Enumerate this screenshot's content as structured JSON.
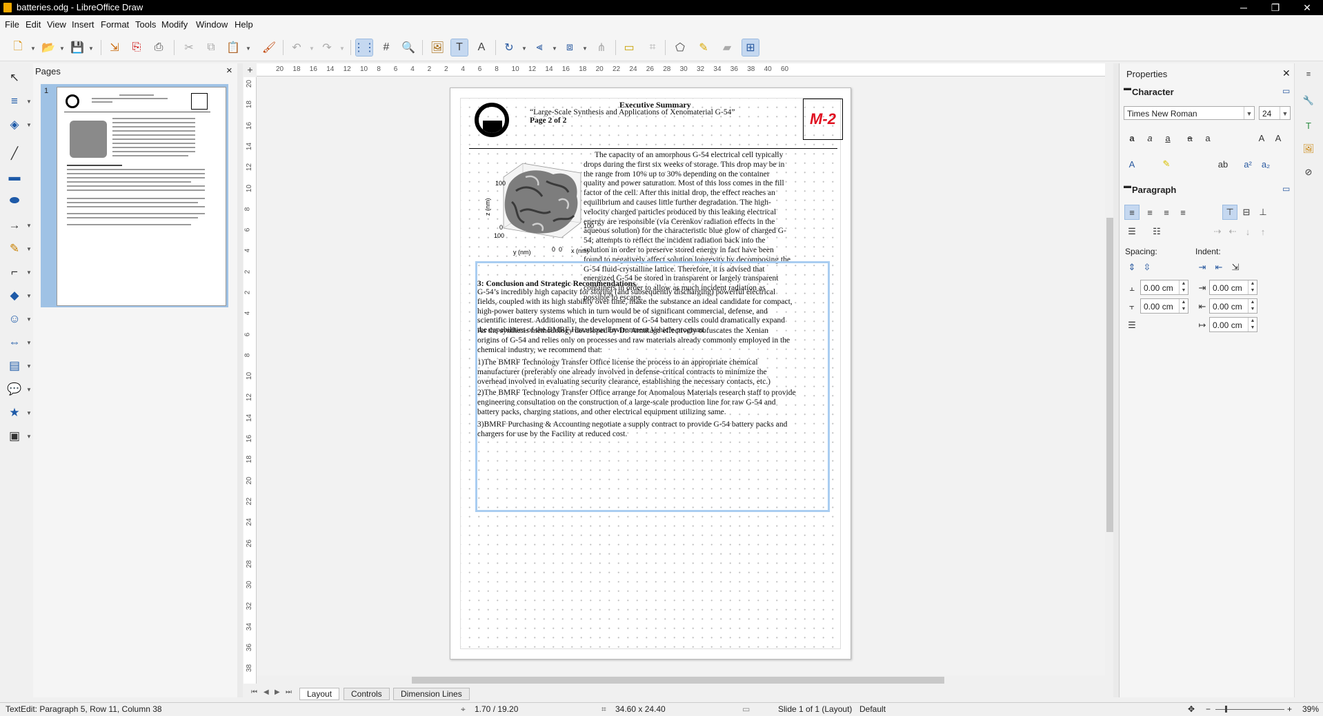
{
  "window": {
    "title": "batteries.odg - LibreOffice Draw",
    "minimize": "─",
    "restore": "❐",
    "close": "✕"
  },
  "menu": [
    "File",
    "Edit",
    "View",
    "Insert",
    "Format",
    "Tools",
    "Modify",
    "Window",
    "Help"
  ],
  "pages_panel": {
    "title": "Pages",
    "close": "×",
    "page_number": "1"
  },
  "rulers": {
    "horizontal": [
      "20",
      "18",
      "16",
      "14",
      "12",
      "10",
      "8",
      "6",
      "4",
      "2",
      "2",
      "4",
      "6",
      "8",
      "10",
      "12",
      "14",
      "16",
      "18",
      "20",
      "22",
      "24",
      "26",
      "28",
      "30",
      "32",
      "34",
      "36",
      "38",
      "40",
      "60"
    ],
    "vertical": [
      "20",
      "18",
      "16",
      "14",
      "12",
      "10",
      "8",
      "6",
      "4",
      "2",
      "2",
      "4",
      "6",
      "8",
      "10",
      "12",
      "14",
      "16",
      "18",
      "20",
      "22",
      "24",
      "26",
      "28",
      "30",
      "32",
      "34",
      "36",
      "38"
    ]
  },
  "document": {
    "title": "Executive Summary",
    "subtitle": "“Large-Scale Synthesis and Applications of Xenomaterial G-54”",
    "page_info": "Page 2 of 2",
    "logo_text": "M-2",
    "plot_labels": {
      "z_axis": "z (nm)",
      "y_axis": "y (nm)",
      "x_axis": "x (nm)",
      "z_max": "100",
      "z_min": "0",
      "y_max": "100",
      "y_min": "0",
      "x_min": "0",
      "x_max": "100"
    },
    "intro_paragraph": "The capacity of an amorphous G-54 electrical cell typically\ndrops during the first six weeks of storage. This drop may be in\nthe range from 10% up to 30% depending on the container\nquality and power saturation. Most of this loss comes in the fill\nfactor of the cell. After this initial drop, the effect reaches an\nequilibrium and causes little further degradation. The high-\nvelocity charged particles produced by this leaking electrical\nenergy are responsible (via Cerenkov radiation effects in the\naqueous solution) for the characteristic blue glow of charged G-\n54; attempts to reflect the incident radiation back into the\nsolution in order to preserve stored energy in fact have been\nfound to negatively affect solution longevity by decomposing the\nG-54 fluid-crystalline lattice. Therefore, it is advised that\nenergized G-54 be stored in transparent or largely transparent\ncontainers in order to allow as much incident radiation as\npossible to escape.",
    "section_heading": "3: Conclusion and Strategic Recommendations",
    "conclusion_p1": "G-54’s incredibly high capacity for storing (and subsequently discharging) powerful electrical\nfields, coupled with its high stability over time, make the substance an ideal candidate for compact,\nhigh-power battery systems which in turn would be of significant commercial, defense, and\nscientific interest. Additionally, the development of G-54 battery cells could dramatically expand\nthe capabilities of the BMRF Hazardous Environment Vehicle program.",
    "conclusion_p2": "As the synthesis methodology developed by Dr. Armitage effectively obfuscates the Xenian\norigins of G-54 and relies only on processes and raw materials already commonly employed in the\nchemical industry, we recommend that:",
    "rec_1": "1)The BMRF Technology Transfer Office license the process to an appropriate chemical\nmanufacturer (preferably one already involved in defense-critical contracts to minimize the\noverhead involved in evaluating security clearance, establishing the necessary contacts, etc.)",
    "rec_2": "2)The BMRF Technology Transfer Office arrange for Anomalous Materials research staff to provide\nengineering consultation on the construction of a large-scale production line for raw G-54 and\nbattery packs, charging stations, and other electrical equipment utilizing same.",
    "rec_3": "3)BMRF Purchasing & Accounting negotiate a supply contract to provide G-54 battery packs and\nchargers for use by the Facility at reduced cost."
  },
  "tabs": [
    "Layout",
    "Controls",
    "Dimension Lines"
  ],
  "sidebar": {
    "title": "Properties",
    "close": "✕",
    "character_section": "Character",
    "font_name": "Times New Roman",
    "font_size": "24",
    "paragraph_section": "Paragraph",
    "spacing_label": "Spacing:",
    "indent_label": "Indent:",
    "spacing_above": "0.00 cm",
    "spacing_below": "0.00 cm",
    "indent_before": "0.00 cm",
    "indent_after": "0.00 cm",
    "indent_first": "0.00 cm"
  },
  "status": {
    "edit_info": "TextEdit: Paragraph 5, Row 11, Column 38",
    "position": "1.70 / 19.20",
    "size": "34.60 x 24.40",
    "slide": "Slide 1 of 1 (Layout)",
    "master": "Default",
    "zoom": "39%"
  }
}
